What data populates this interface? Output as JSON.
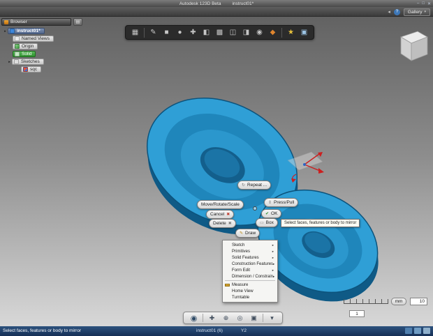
{
  "colors": {
    "accent_blue": "#2f9fd6",
    "selection_green": "#3a9a3a",
    "statusbar_blue": "#1c3c64"
  },
  "window": {
    "app_title": "Autodesk 123D Beta",
    "doc_title": "instruct01*",
    "minimize": "–",
    "maximize": "□",
    "close": "✕"
  },
  "menubar": {
    "back_arrow": "◂",
    "help": "?",
    "gallery": "Gallery",
    "gallery_arrow": "▾"
  },
  "browser": {
    "title": "Browser",
    "panel_icon": "▤",
    "twisty": "▸",
    "tree": [
      {
        "label": "instruct01*"
      },
      {
        "label": "Named Views"
      },
      {
        "label": "Origin"
      },
      {
        "label": "Solid"
      },
      {
        "label": "Sketches"
      },
      {
        "label": "sqc"
      }
    ]
  },
  "toolbar": {
    "icons": [
      {
        "name": "main-menu",
        "glyph": "▦"
      },
      {
        "name": "sketch",
        "glyph": "✎"
      },
      {
        "name": "primitives",
        "glyph": "■"
      },
      {
        "name": "create",
        "glyph": "●"
      },
      {
        "name": "modify",
        "glyph": "✚"
      },
      {
        "name": "mirror",
        "glyph": "◧"
      },
      {
        "name": "pattern",
        "glyph": "▩"
      },
      {
        "name": "combine",
        "glyph": "◫"
      },
      {
        "name": "split",
        "glyph": "◨"
      },
      {
        "name": "material",
        "glyph": "◉"
      },
      {
        "name": "paint",
        "glyph": "◆"
      },
      {
        "name": "effects",
        "glyph": "★"
      },
      {
        "name": "snapshot",
        "glyph": "▣"
      }
    ]
  },
  "marking_menu": {
    "repeat_icon": "↻",
    "repeat": "Repeat ...",
    "move_rotate_scale": "Move/Rotate/Scale",
    "press_pull_icon": "⇕",
    "press_pull": "Press/Pull",
    "cancel": "Cancel",
    "cancel_icon": "✖",
    "ok_icon": "✔",
    "ok": "OK",
    "delete": "Delete",
    "delete_icon": "✖",
    "box_icon": "▭",
    "box": "Box",
    "draw_icon": "✎",
    "draw": "Draw"
  },
  "tooltip": {
    "text": "Select faces, features or body to mirror"
  },
  "submenu": {
    "arrow": "▸",
    "items": [
      {
        "label": "Sketch"
      },
      {
        "label": "Primitives"
      },
      {
        "label": "Solid Features"
      },
      {
        "label": "Construction Features"
      },
      {
        "label": "Form Edit"
      },
      {
        "label": "Dimension / Constrain"
      },
      {
        "label": "Measure"
      },
      {
        "label": "Home View"
      },
      {
        "label": "Turntable"
      }
    ]
  },
  "navbar": {
    "icons": [
      {
        "name": "navigation-wheel",
        "glyph": "◉"
      },
      {
        "name": "pan",
        "glyph": "✚"
      },
      {
        "name": "zoom",
        "glyph": "⊕"
      },
      {
        "name": "orbit",
        "glyph": "◎"
      },
      {
        "name": "look-at",
        "glyph": "▣"
      },
      {
        "name": "display-settings",
        "glyph": "▾"
      }
    ]
  },
  "scale_widget": {
    "unit": "mm",
    "value": "10",
    "secondary": "1"
  },
  "statusbar": {
    "message": "Select faces, features or body to mirror",
    "doc_label": "instruct01 (6)",
    "coord_label": "Y2"
  }
}
